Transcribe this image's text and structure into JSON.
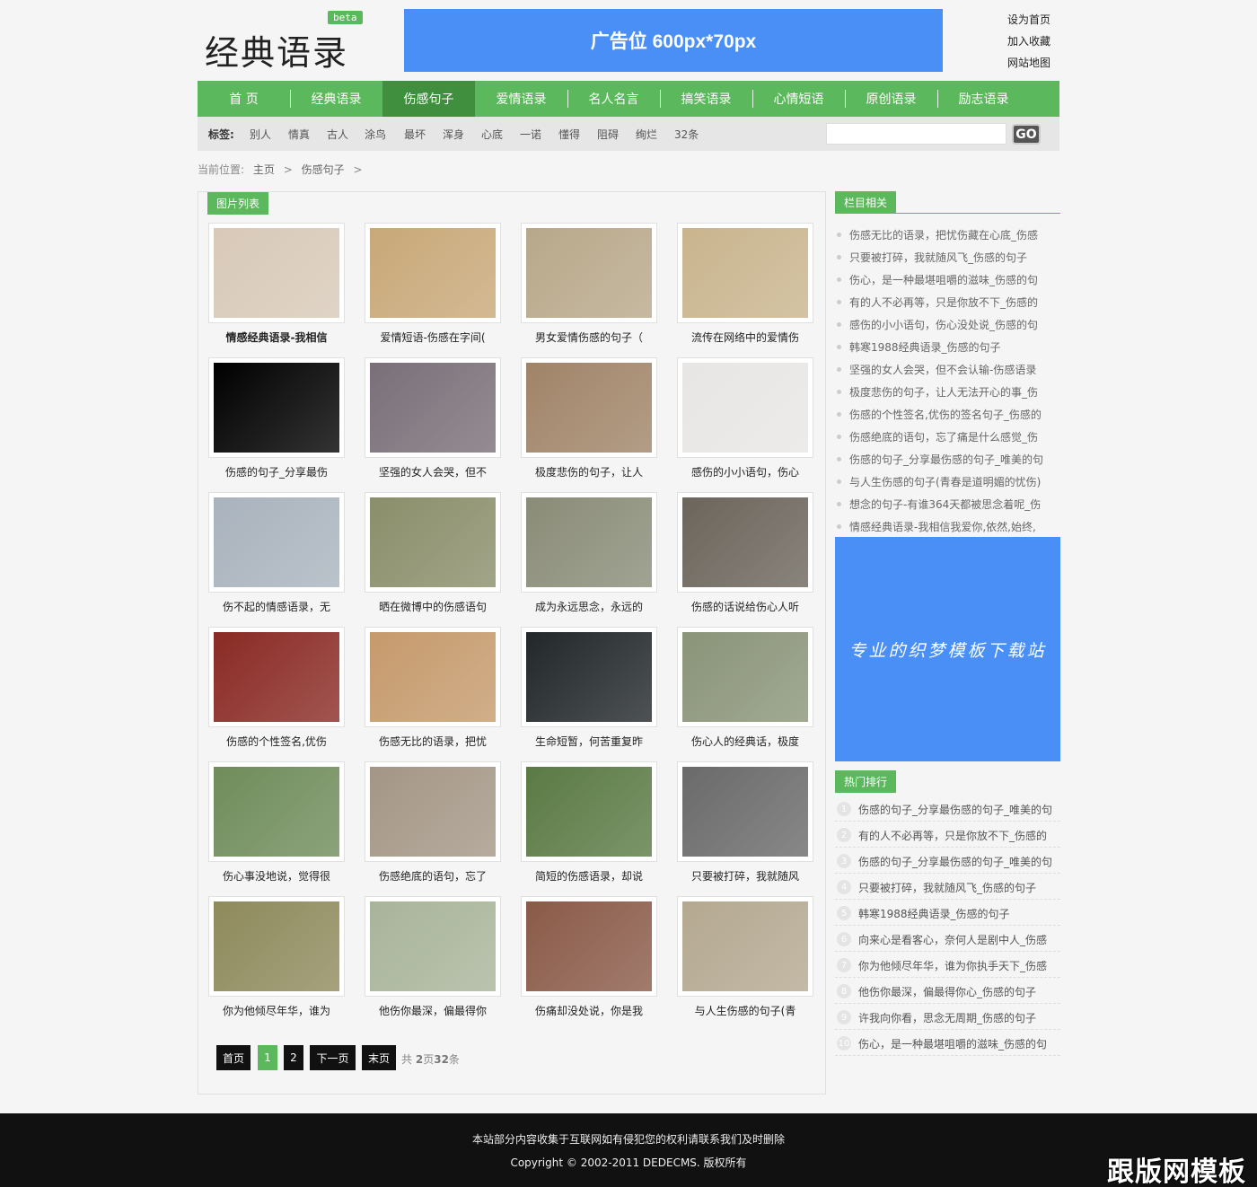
{
  "header": {
    "logo_text": "经典语录",
    "beta_badge": "beta",
    "ad_text": "广告位 600px*70px",
    "links": [
      "设为首页",
      "加入收藏",
      "网站地图"
    ]
  },
  "nav": {
    "items": [
      "首 页",
      "经典语录",
      "伤感句子",
      "爱情语录",
      "名人名言",
      "搞笑语录",
      "心情短语",
      "原创语录",
      "励志语录"
    ],
    "active": "伤感句子"
  },
  "tags": {
    "label": "标签:",
    "items": [
      "别人",
      "情真",
      "古人",
      "涂鸟",
      "最坏",
      "浑身",
      "心底",
      "一诺",
      "懂得",
      "阻碍",
      "绚烂",
      "32条"
    ],
    "search_placeholder": "",
    "go_label": "GO"
  },
  "breadcrumb": {
    "prefix": "当前位置:",
    "items": [
      "主页",
      ">",
      "伤感句子",
      ">"
    ]
  },
  "main": {
    "section_title": "图片列表",
    "cards": [
      {
        "title": "情感经典语录-我相信",
        "color": "#d8c9b8"
      },
      {
        "title": "爱情短语-伤感在字间(",
        "color": "#c8a878"
      },
      {
        "title": "男女爱情伤感的句子（",
        "color": "#b8a88a"
      },
      {
        "title": "流传在网络中的爱情伤",
        "color": "#c9b48d"
      },
      {
        "title": "伤感的句子_分享最伤",
        "color": "#000000"
      },
      {
        "title": "坚强的女人会哭，但不",
        "color": "#7a6f78"
      },
      {
        "title": "极度悲伤的句子，让人",
        "color": "#a08468"
      },
      {
        "title": "感伤的小小语句，伤心",
        "color": "#e8e6e4"
      },
      {
        "title": "伤不起的情感语录，无",
        "color": "#a9b3bd"
      },
      {
        "title": "晒在微博中的伤感语句",
        "color": "#8a8e6a"
      },
      {
        "title": "成为永远思念，永远的",
        "color": "#8a8c78"
      },
      {
        "title": "伤感的话说给伤心人听",
        "color": "#6b655b"
      },
      {
        "title": "伤感的个性签名,优伤",
        "color": "#8a2a24"
      },
      {
        "title": "伤感无比的语录，把忧",
        "color": "#c59a6c"
      },
      {
        "title": "生命短暂，何苦重复昨",
        "color": "#22272a"
      },
      {
        "title": "伤心人的经典话，极度",
        "color": "#8a9478"
      },
      {
        "title": "伤心事没地说，觉得很",
        "color": "#6f8c5a"
      },
      {
        "title": "伤感绝底的语句，忘了",
        "color": "#a49686"
      },
      {
        "title": "简短的伤感语录，却说",
        "color": "#5a7a44"
      },
      {
        "title": "只要被打碎，我就随风",
        "color": "#6a6a6a"
      },
      {
        "title": "你为他倾尽年华，谁为",
        "color": "#8e8a5c"
      },
      {
        "title": "他伤你最深，偏最得你",
        "color": "#a8b49a"
      },
      {
        "title": "伤痛却没处说，你是我",
        "color": "#8a5a48"
      },
      {
        "title": "与人生伤感的句子(青",
        "color": "#b4a890"
      }
    ],
    "pagination": {
      "buttons": [
        "首页",
        "1",
        "2",
        "下一页",
        "末页"
      ],
      "current": "1",
      "info_prefix": "共",
      "pages": "2",
      "pages_suffix": "页",
      "count": "32",
      "count_suffix": "条"
    }
  },
  "sidebar": {
    "related_title": "栏目相关",
    "related": [
      "伤感无比的语录，把忧伤藏在心底_伤感",
      "只要被打碎，我就随风飞_伤感的句子",
      "伤心，是一种最堪咀嚼的滋味_伤感的句",
      "有的人不必再等，只是你放不下_伤感的",
      "感伤的小小语句，伤心没处说_伤感的句",
      "韩寒1988经典语录_伤感的句子",
      "坚强的女人会哭，但不会认输-伤感语录",
      "极度悲伤的句子，让人无法开心的事_伤",
      "伤感的个性签名,优伤的签名句子_伤感的",
      "伤感绝底的语句，忘了痛是什么感觉_伤",
      "伤感的句子_分享最伤感的句子_唯美的句",
      "与人生伤感的句子(青春是道明媚的忧伤)",
      "想念的句子-有谁364天都被思念着呢_伤",
      "情感经典语录-我相信我爱你,依然,始终,"
    ],
    "ad_text": "专业的织梦模板下载站",
    "hot_title": "热门排行",
    "hot": [
      "伤感的句子_分享最伤感的句子_唯美的句",
      "有的人不必再等，只是你放不下_伤感的",
      "伤感的句子_分享最伤感的句子_唯美的句",
      "只要被打碎，我就随风飞_伤感的句子",
      "韩寒1988经典语录_伤感的句子",
      "向来心是看客心，奈何人是剧中人_伤感",
      "你为他倾尽年华，谁为你执手天下_伤感",
      "他伤你最深，偏最得你心_伤感的句子",
      "许我向你看，思念无周期_伤感的句子",
      "伤心，是一种最堪咀嚼的滋味_伤感的句"
    ]
  },
  "footer": {
    "line1": "本站部分内容收集于互联网如有侵犯您的权利请联系我们及时删除",
    "line2": "Copyright © 2002-2011 DEDECMS. 版权所有",
    "watermark": "跟版网模板"
  }
}
